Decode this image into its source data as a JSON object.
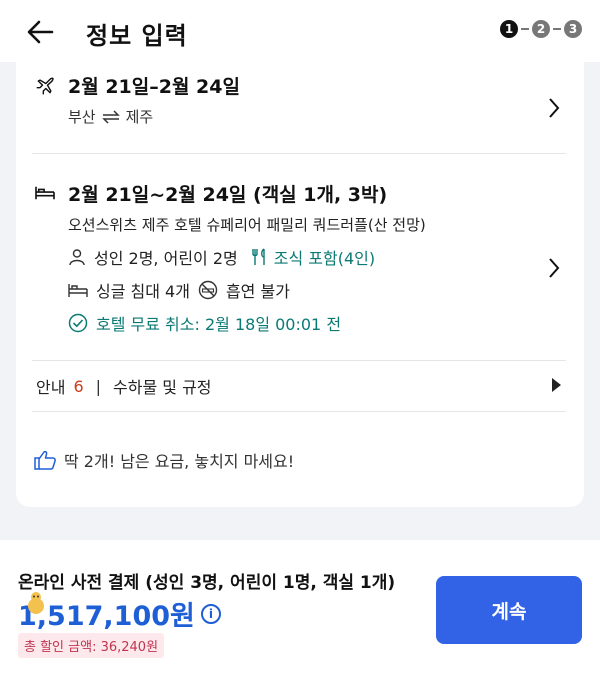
{
  "header": {
    "title": "정보 입력",
    "steps": [
      "1",
      "2",
      "3"
    ],
    "current_step": 1
  },
  "flight": {
    "dates": "2월 21일–2월 24일",
    "from": "부산",
    "to": "제주",
    "route_icon": "swap-arrows-icon"
  },
  "hotel": {
    "dates": "2월 21일~2월 24일 (객실 1개, 3박)",
    "name": "오션스위츠 제주 호텔 슈페리어 패밀리 쿼드러플(산 전망)",
    "guests": "성인 2명, 어린이 2명",
    "meal": "조식 포함(4인)",
    "beds": "싱글 침대 4개",
    "smoking": "흡연 불가",
    "cancellation": "호텔 무료 취소: 2월 18일 00:01 전"
  },
  "info": {
    "label": "안내",
    "count": "6",
    "separator": "|",
    "rules": "수하물 및 규정"
  },
  "deal": {
    "message": "딱 2개! 남은 요금, 놓치지 마세요!"
  },
  "footer": {
    "payment_label": "온라인 사전 결제 (성인 3명, 어린이 1명, 객실 1개)",
    "price": "1,517,100원",
    "discount": "총 할인 금액: 36,240원",
    "continue_label": "계속"
  },
  "colors": {
    "accent": "#3262e6",
    "price": "#1f5fd6",
    "teal": "#0b7a75",
    "discount_bg": "#fde8ec",
    "discount_text": "#c0354f"
  }
}
